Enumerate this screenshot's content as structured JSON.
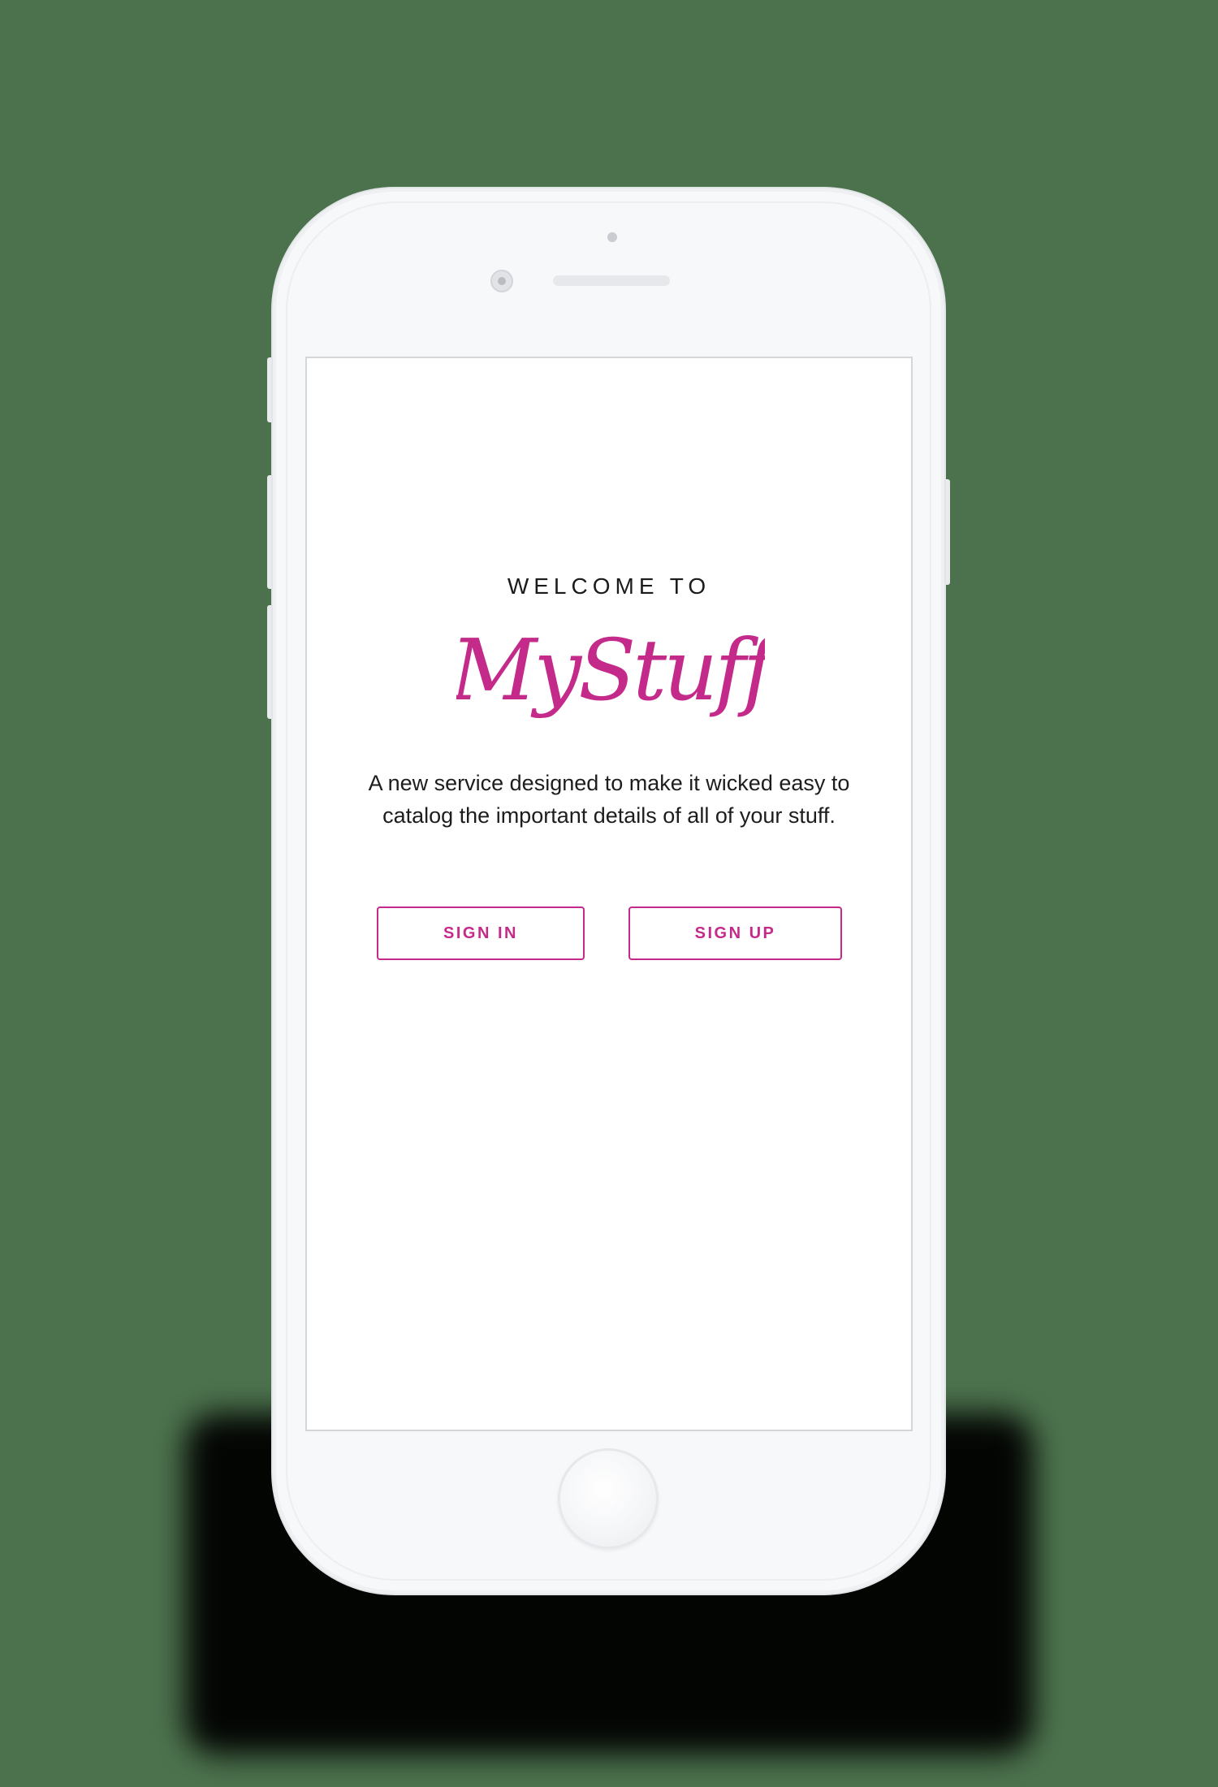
{
  "screen": {
    "welcome_text": "WELCOME TO",
    "logo_text": "MyStuff",
    "tagline": "A new service designed to make it wicked easy to catalog the important details of all of your stuff.",
    "buttons": {
      "sign_in": "SIGN IN",
      "sign_up": "SIGN UP"
    }
  },
  "colors": {
    "background": "#4c724d",
    "accent": "#c42a8a",
    "phone_body": "#f7f8fa",
    "screen": "#ffffff",
    "text": "#1b1b1b"
  },
  "icons": {
    "front_sensor": "sensor-dot-icon",
    "front_camera": "camera-icon",
    "earpiece": "speaker-icon",
    "home": "home-button-icon"
  }
}
